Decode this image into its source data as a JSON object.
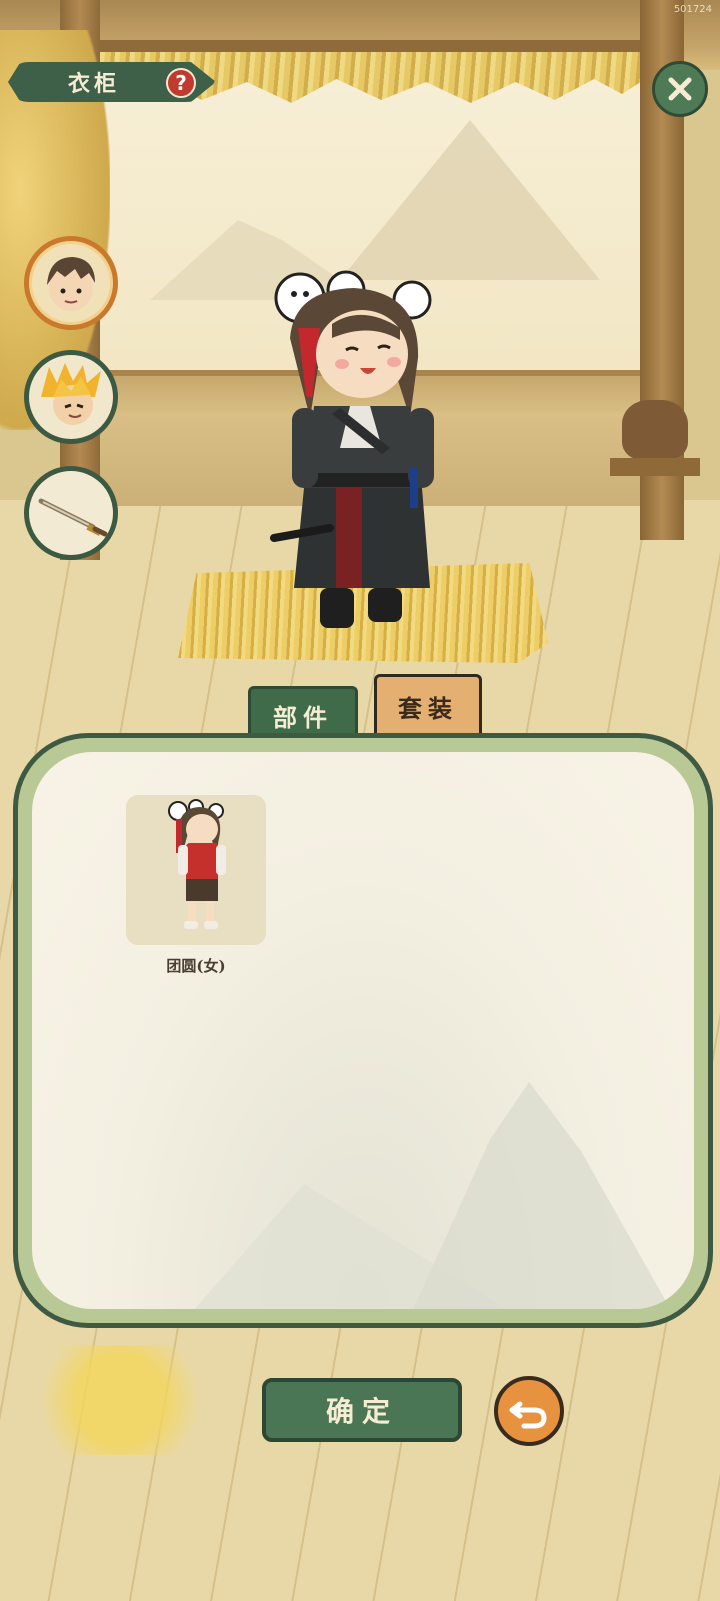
{
  "overlay_text": "501724",
  "header": {
    "title": "衣柜",
    "help_glyph": "?",
    "help_icon": "question-icon",
    "close_icon": "close-x-icon"
  },
  "side_buttons": [
    {
      "icon": "hairstyle-portrait-icon",
      "selected": true
    },
    {
      "icon": "golden-hair-portrait-icon",
      "selected": false
    },
    {
      "icon": "sword-icon",
      "selected": false
    }
  ],
  "tabs": [
    {
      "label": "部件",
      "active": true
    },
    {
      "label": "套装",
      "active": false
    }
  ],
  "items": [
    {
      "label": "团圆(女)",
      "icon": "outfit-preview-icon"
    }
  ],
  "footer": {
    "confirm_label": "确定",
    "undo_icon": "undo-arrow-icon"
  },
  "colors": {
    "primary_green": "#3f6b4b",
    "accent_orange": "#e7923e",
    "tab_inactive": "#e3b071",
    "panel_border": "#3f5a43"
  }
}
